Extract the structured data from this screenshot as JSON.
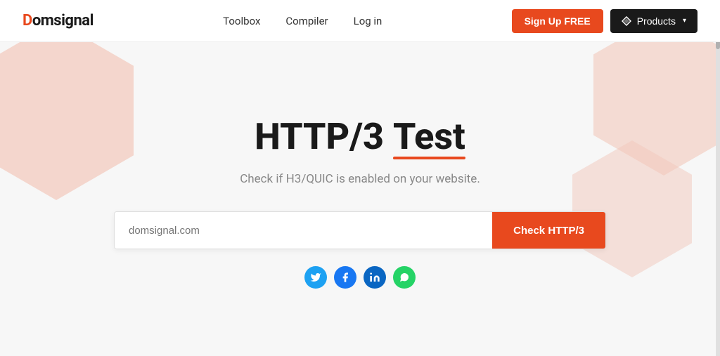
{
  "navbar": {
    "logo_d": "D",
    "logo_rest": "omsignal",
    "links": [
      {
        "label": "Toolbox",
        "id": "toolbox"
      },
      {
        "label": "Compiler",
        "id": "compiler"
      },
      {
        "label": "Log in",
        "id": "login"
      }
    ],
    "signup_label": "Sign Up FREE",
    "products_label": "Products"
  },
  "hero": {
    "title_part1": "HTTP/3 ",
    "title_part2": "Test",
    "subtitle": "Check if H3/QUIC is enabled on your website.",
    "input_placeholder": "domsignal.com",
    "check_button_label": "Check HTTP/3"
  },
  "social": [
    {
      "name": "twitter",
      "symbol": "𝕋",
      "title": "Twitter"
    },
    {
      "name": "facebook",
      "symbol": "f",
      "title": "Facebook"
    },
    {
      "name": "linkedin",
      "symbol": "in",
      "title": "LinkedIn"
    },
    {
      "name": "whatsapp",
      "symbol": "✆",
      "title": "WhatsApp"
    }
  ],
  "colors": {
    "accent": "#e8491e",
    "dark": "#1a1a1a",
    "hex_bg": "#f2c8bb"
  }
}
